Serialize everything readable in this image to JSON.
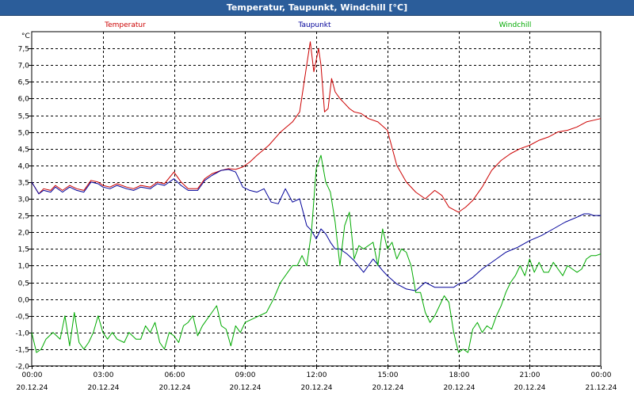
{
  "window": {
    "title": "Temperatur, Taupunkt, Windchill [°C]"
  },
  "chart_data": {
    "type": "line",
    "title": "Temperatur, Taupunkt, Windchill [°C]",
    "ylabel": "°C",
    "xlabel": "",
    "ylim": [
      -2.0,
      8.0
    ],
    "y_ticks": [
      "7,5",
      "7,0",
      "6,5",
      "6,0",
      "5,5",
      "5,0",
      "4,5",
      "4,0",
      "3,5",
      "3,0",
      "2,5",
      "2,0",
      "1,5",
      "1,0",
      "0,5",
      "0,0",
      "-0,5",
      "-1,0",
      "-1,5",
      "-2,0"
    ],
    "x_ticks": [
      {
        "time": "00:00",
        "date": "20.12.24"
      },
      {
        "time": "03:00",
        "date": "20.12.24"
      },
      {
        "time": "06:00",
        "date": "20.12.24"
      },
      {
        "time": "09:00",
        "date": "20.12.24"
      },
      {
        "time": "12:00",
        "date": "20.12.24"
      },
      {
        "time": "15:00",
        "date": "20.12.24"
      },
      {
        "time": "18:00",
        "date": "20.12.24"
      },
      {
        "time": "21:00",
        "date": "20.12.24"
      },
      {
        "time": "00:00",
        "date": "21.12.24"
      }
    ],
    "x_range_hours": [
      0,
      24
    ],
    "grid": true,
    "legend_position": "top",
    "series": [
      {
        "name": "Temperatur",
        "color": "#cc0000",
        "x_hours": [
          0.0,
          0.3,
          0.5,
          0.8,
          1.0,
          1.3,
          1.6,
          1.9,
          2.2,
          2.5,
          2.8,
          3.0,
          3.3,
          3.6,
          4.0,
          4.3,
          4.6,
          5.0,
          5.3,
          5.6,
          6.0,
          6.3,
          6.6,
          7.0,
          7.3,
          7.6,
          8.0,
          8.3,
          8.6,
          8.9,
          9.2,
          9.5,
          10.0,
          10.5,
          11.0,
          11.3,
          11.6,
          11.75,
          11.9,
          12.1,
          12.2,
          12.35,
          12.5,
          12.65,
          12.8,
          13.0,
          13.2,
          13.4,
          13.6,
          13.9,
          14.2,
          14.6,
          15.0,
          15.4,
          15.8,
          16.2,
          16.6,
          17.0,
          17.3,
          17.6,
          18.0,
          18.3,
          18.6,
          19.0,
          19.4,
          19.8,
          20.2,
          20.6,
          21.0,
          21.4,
          21.8,
          22.2,
          22.6,
          23.0,
          23.4,
          23.7,
          24.0
        ],
        "values": [
          3.5,
          3.15,
          3.3,
          3.25,
          3.4,
          3.25,
          3.4,
          3.3,
          3.25,
          3.55,
          3.5,
          3.4,
          3.35,
          3.45,
          3.35,
          3.3,
          3.4,
          3.35,
          3.5,
          3.45,
          3.8,
          3.5,
          3.3,
          3.3,
          3.6,
          3.75,
          3.85,
          3.9,
          3.88,
          3.95,
          4.1,
          4.3,
          4.6,
          5.0,
          5.3,
          5.6,
          7.0,
          7.7,
          6.8,
          7.5,
          7.0,
          5.6,
          5.7,
          6.6,
          6.2,
          6.0,
          5.85,
          5.7,
          5.6,
          5.55,
          5.4,
          5.3,
          5.05,
          4.0,
          3.5,
          3.2,
          3.0,
          3.25,
          3.1,
          2.75,
          2.6,
          2.75,
          2.95,
          3.35,
          3.85,
          4.15,
          4.35,
          4.5,
          4.6,
          4.75,
          4.85,
          5.0,
          5.05,
          5.15,
          5.3,
          5.35,
          5.4
        ]
      },
      {
        "name": "Taupunkt",
        "color": "#000099",
        "x_hours": [
          0.0,
          0.3,
          0.5,
          0.8,
          1.0,
          1.3,
          1.6,
          1.9,
          2.2,
          2.5,
          2.8,
          3.0,
          3.3,
          3.6,
          4.0,
          4.3,
          4.6,
          5.0,
          5.3,
          5.6,
          6.0,
          6.3,
          6.6,
          7.0,
          7.3,
          7.6,
          8.0,
          8.3,
          8.6,
          8.9,
          9.2,
          9.5,
          9.8,
          10.1,
          10.4,
          10.7,
          11.0,
          11.3,
          11.6,
          11.8,
          12.0,
          12.2,
          12.4,
          12.6,
          12.8,
          13.0,
          13.3,
          13.6,
          14.0,
          14.4,
          14.8,
          15.0,
          15.4,
          15.8,
          16.2,
          16.6,
          17.0,
          17.4,
          17.8,
          18.0,
          18.3,
          18.6,
          19.0,
          19.5,
          20.0,
          20.5,
          21.0,
          21.5,
          22.0,
          22.5,
          23.0,
          23.3,
          23.5,
          23.7,
          24.0
        ],
        "values": [
          3.5,
          3.15,
          3.25,
          3.2,
          3.35,
          3.2,
          3.35,
          3.25,
          3.2,
          3.5,
          3.45,
          3.35,
          3.3,
          3.4,
          3.3,
          3.25,
          3.35,
          3.3,
          3.45,
          3.4,
          3.6,
          3.4,
          3.25,
          3.25,
          3.55,
          3.7,
          3.85,
          3.88,
          3.8,
          3.35,
          3.25,
          3.2,
          3.3,
          2.9,
          2.85,
          3.3,
          2.9,
          3.0,
          2.2,
          2.05,
          1.8,
          2.1,
          1.95,
          1.7,
          1.5,
          1.5,
          1.35,
          1.15,
          0.8,
          1.2,
          0.85,
          0.7,
          0.45,
          0.3,
          0.25,
          0.5,
          0.35,
          0.35,
          0.35,
          0.45,
          0.5,
          0.65,
          0.9,
          1.15,
          1.4,
          1.55,
          1.75,
          1.9,
          2.1,
          2.3,
          2.45,
          2.55,
          2.55,
          2.5,
          2.5
        ]
      },
      {
        "name": "Windchill",
        "color": "#00aa00",
        "x_hours": [
          0.0,
          0.2,
          0.4,
          0.6,
          0.9,
          1.2,
          1.4,
          1.6,
          1.8,
          2.0,
          2.2,
          2.4,
          2.6,
          2.8,
          3.0,
          3.2,
          3.4,
          3.6,
          3.9,
          4.1,
          4.4,
          4.6,
          4.8,
          5.0,
          5.2,
          5.4,
          5.6,
          5.8,
          6.0,
          6.2,
          6.4,
          6.6,
          6.8,
          7.0,
          7.2,
          7.4,
          7.6,
          7.8,
          8.0,
          8.2,
          8.4,
          8.6,
          8.8,
          9.0,
          9.3,
          9.6,
          9.9,
          10.2,
          10.5,
          10.8,
          11.0,
          11.2,
          11.4,
          11.6,
          11.8,
          12.0,
          12.2,
          12.4,
          12.6,
          12.8,
          13.0,
          13.2,
          13.4,
          13.6,
          13.8,
          14.0,
          14.2,
          14.4,
          14.6,
          14.8,
          15.0,
          15.2,
          15.4,
          15.6,
          15.8,
          16.0,
          16.2,
          16.4,
          16.6,
          16.8,
          17.0,
          17.2,
          17.4,
          17.6,
          17.8,
          18.0,
          18.2,
          18.4,
          18.6,
          18.8,
          19.0,
          19.2,
          19.4,
          19.6,
          19.8,
          20.0,
          20.2,
          20.4,
          20.6,
          20.8,
          21.0,
          21.2,
          21.4,
          21.6,
          21.8,
          22.0,
          22.2,
          22.4,
          22.6,
          22.8,
          23.0,
          23.2,
          23.4,
          23.6,
          23.8,
          24.0
        ],
        "values": [
          -1.0,
          -1.6,
          -1.5,
          -1.2,
          -1.0,
          -1.2,
          -0.5,
          -1.4,
          -0.4,
          -1.3,
          -1.5,
          -1.3,
          -1.0,
          -0.5,
          -1.0,
          -1.2,
          -1.0,
          -1.2,
          -1.3,
          -1.0,
          -1.2,
          -1.2,
          -0.8,
          -1.0,
          -0.7,
          -1.3,
          -1.5,
          -1.0,
          -1.1,
          -1.3,
          -0.8,
          -0.7,
          -0.5,
          -1.1,
          -0.8,
          -0.6,
          -0.4,
          -0.2,
          -0.8,
          -0.9,
          -1.4,
          -0.8,
          -1.0,
          -0.7,
          -0.6,
          -0.5,
          -0.4,
          0.0,
          0.5,
          0.8,
          1.0,
          1.0,
          1.3,
          1.0,
          2.0,
          3.9,
          4.3,
          3.5,
          3.2,
          2.3,
          1.0,
          2.2,
          2.6,
          1.2,
          1.6,
          1.5,
          1.6,
          1.7,
          1.0,
          2.1,
          1.5,
          1.7,
          1.2,
          1.5,
          1.4,
          1.0,
          0.2,
          0.2,
          -0.4,
          -0.7,
          -0.5,
          -0.2,
          0.1,
          -0.1,
          -1.0,
          -1.6,
          -1.5,
          -1.6,
          -0.9,
          -0.7,
          -1.0,
          -0.8,
          -0.9,
          -0.5,
          -0.2,
          0.2,
          0.5,
          0.7,
          1.0,
          0.7,
          1.2,
          0.8,
          1.1,
          0.8,
          0.8,
          1.1,
          0.9,
          0.7,
          1.0,
          0.9,
          0.8,
          0.9,
          1.2,
          1.3,
          1.3,
          1.35
        ]
      }
    ]
  }
}
